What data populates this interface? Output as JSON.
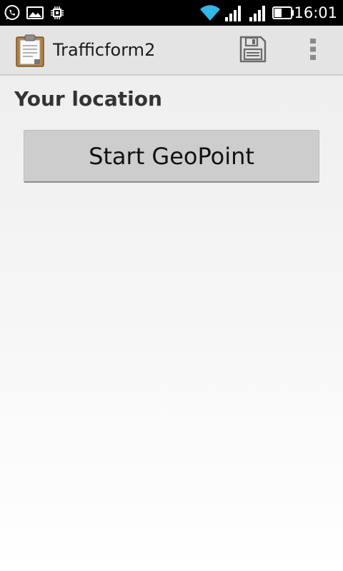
{
  "status_bar": {
    "time": "16:01",
    "icons": [
      "whatsapp-icon",
      "gallery-icon",
      "chip-icon",
      "wifi-icon",
      "signal-1-icon",
      "signal-2-icon",
      "battery-icon"
    ]
  },
  "action_bar": {
    "title": "Trafficform2",
    "app_icon": "clipboard-icon",
    "actions": [
      "save-icon",
      "overflow-menu-icon"
    ]
  },
  "form": {
    "question_label": "Your location",
    "geo_button_label": "Start GeoPoint"
  },
  "colors": {
    "status_bar_bg": "#000000",
    "action_bar_bg": "#e4e4e4",
    "wifi_accent": "#33b5e5",
    "button_bg": "#cdcdcd"
  }
}
